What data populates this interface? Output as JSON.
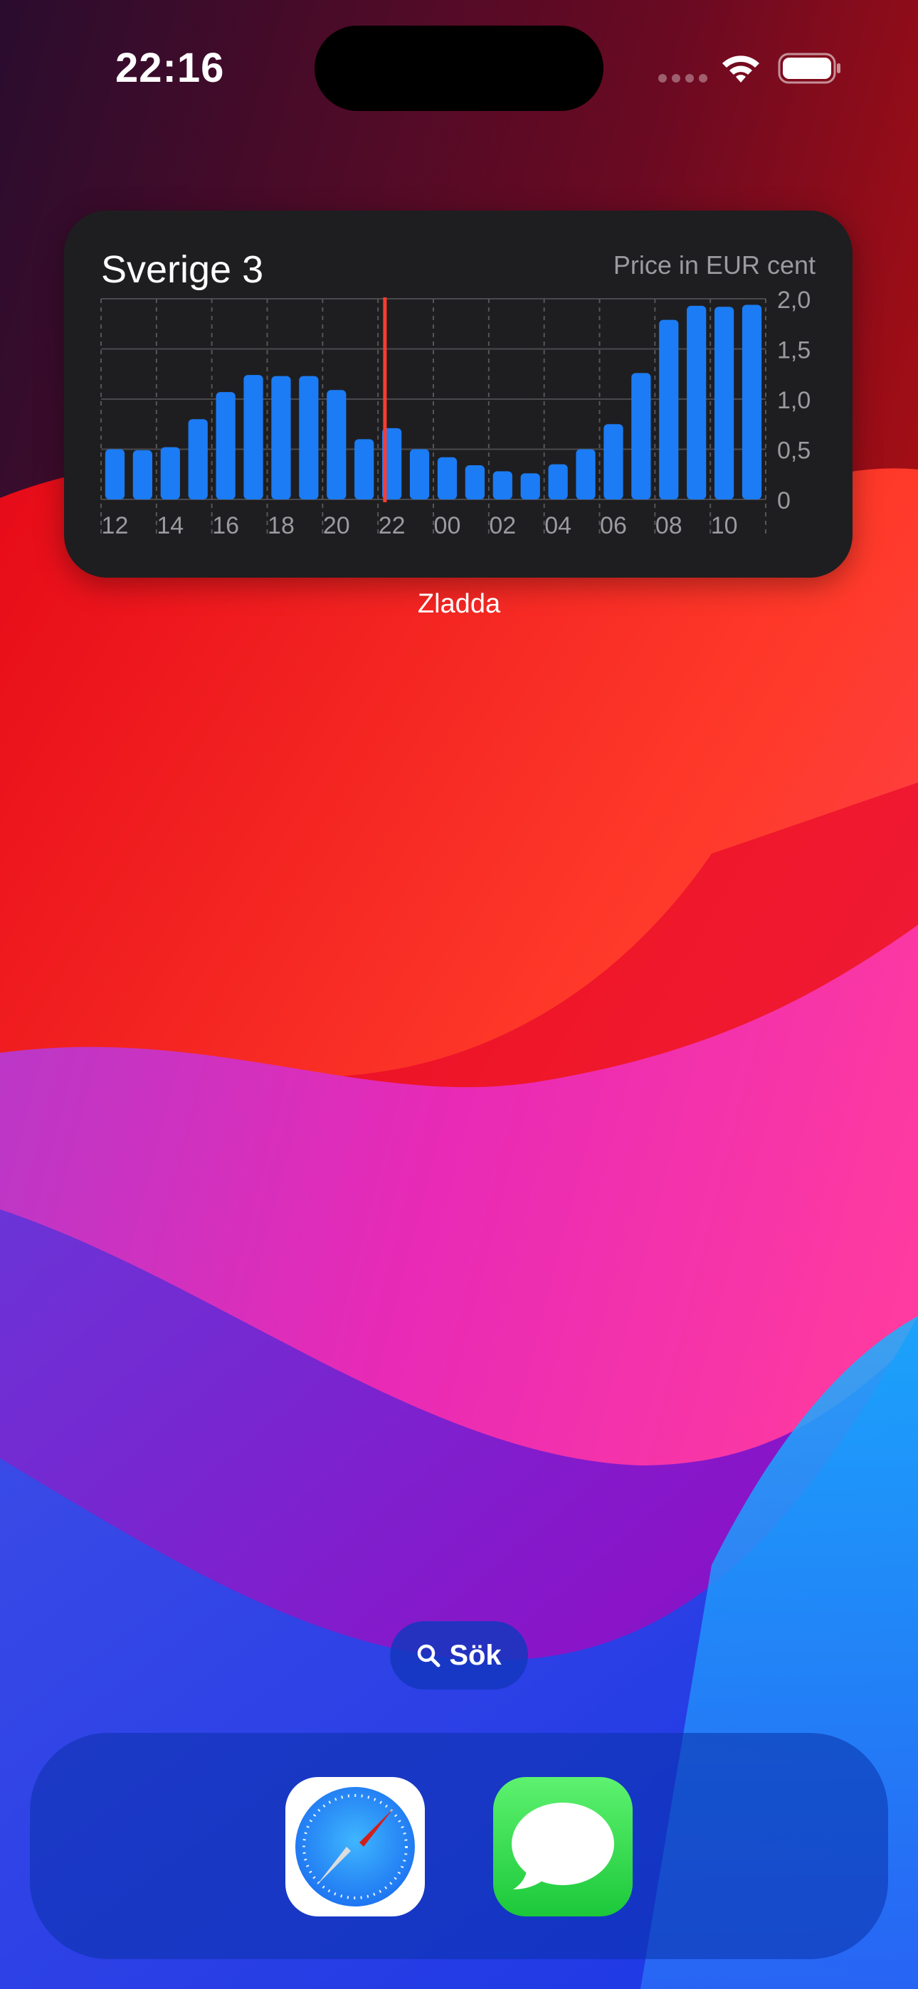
{
  "status_bar": {
    "time": "22:16"
  },
  "widget": {
    "title": "Sverige 3",
    "unit_label": "Price in EUR cent",
    "app_name": "Zladda"
  },
  "chart_data": {
    "type": "bar",
    "categories": [
      "12",
      "13",
      "14",
      "15",
      "16",
      "17",
      "18",
      "19",
      "20",
      "21",
      "22",
      "23",
      "00",
      "01",
      "02",
      "03",
      "04",
      "05",
      "06",
      "07",
      "08",
      "09",
      "10",
      "11"
    ],
    "x_tick_labels": [
      "12",
      "14",
      "16",
      "18",
      "20",
      "22",
      "00",
      "02",
      "04",
      "06",
      "08",
      "10"
    ],
    "values": [
      0.5,
      0.49,
      0.52,
      0.8,
      1.07,
      1.24,
      1.23,
      1.23,
      1.09,
      0.6,
      0.71,
      0.5,
      0.42,
      0.34,
      0.28,
      0.26,
      0.35,
      0.5,
      0.75,
      1.26,
      1.79,
      1.93,
      1.92,
      1.94
    ],
    "current_hour": "22",
    "y_ticks": [
      "2,0",
      "1,5",
      "1,0",
      "0,5",
      "0"
    ],
    "ylim": [
      0,
      2.0
    ],
    "grid": true,
    "bar_color": "#1b7cf5",
    "now_line_color": "#ff3b30"
  },
  "search": {
    "label": "Sök"
  },
  "dock": {
    "apps": [
      {
        "name": "Safari",
        "icon": "safari-icon"
      },
      {
        "name": "Meddelanden",
        "icon": "messages-icon"
      }
    ]
  },
  "colors": {
    "widget_bg": "#1e1e20",
    "accent_blue": "#1b7cf5",
    "now_red": "#ff3b30"
  }
}
